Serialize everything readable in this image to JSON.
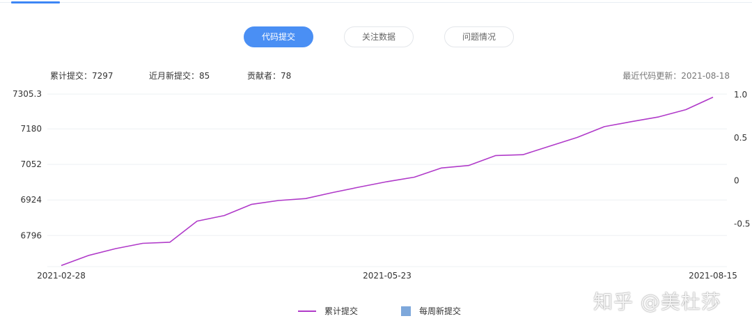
{
  "tabs": [
    {
      "label": "代码提交",
      "active": true
    },
    {
      "label": "关注数据",
      "active": false
    },
    {
      "label": "问题情况",
      "active": false
    }
  ],
  "stats": {
    "total_commits": "累计提交：7297",
    "recent_month": "近月新提交：85",
    "contributors": "贡献者：78",
    "last_update": "最近代码更新：2021-08-18"
  },
  "watermark": "知乎 @美杜莎",
  "colors": {
    "accent": "#4a8ff4",
    "line": "#b03ac9",
    "bar": "#7ea8db"
  },
  "chart_data": {
    "type": "line",
    "title": "",
    "xlabel": "",
    "ylabel": "",
    "x_tick_labels": [
      "2021-02-28",
      "2021-05-23",
      "2021-08-15"
    ],
    "y_tick_labels": [
      "7305.3",
      "7180",
      "7052",
      "6924",
      "6796"
    ],
    "y_ticks": [
      7305.3,
      7180,
      7052,
      6924,
      6796
    ],
    "ylim": [
      6684,
      7318
    ],
    "y2_tick_labels": [
      "1.0",
      "0.5",
      "0",
      "-0.5"
    ],
    "y2_ticks": [
      1.0,
      0.5,
      0,
      -0.5
    ],
    "y2lim": [
      -1.0,
      1.05
    ],
    "grid": true,
    "legend_position": "bottom-center",
    "series": [
      {
        "name": "累计提交",
        "axis": "left",
        "color": "#b03ac9",
        "x": [
          "2021-02-28",
          "2021-03-07",
          "2021-03-14",
          "2021-03-21",
          "2021-03-28",
          "2021-04-04",
          "2021-04-11",
          "2021-04-18",
          "2021-04-25",
          "2021-05-02",
          "2021-05-09",
          "2021-05-16",
          "2021-05-23",
          "2021-05-30",
          "2021-06-06",
          "2021-06-13",
          "2021-06-20",
          "2021-06-27",
          "2021-07-04",
          "2021-07-11",
          "2021-07-18",
          "2021-07-25",
          "2021-08-01",
          "2021-08-08",
          "2021-08-15"
        ],
        "values": [
          6688,
          6724,
          6749,
          6768,
          6772,
          6848,
          6868,
          6908,
          6922,
          6929,
          6951,
          6971,
          6990,
          7006,
          7039,
          7048,
          7084,
          7087,
          7118,
          7149,
          7188,
          7206,
          7223,
          7249,
          7294
        ]
      },
      {
        "name": "每周新提交",
        "axis": "right",
        "color": "#7ea8db",
        "type": "bar",
        "values": []
      }
    ]
  }
}
